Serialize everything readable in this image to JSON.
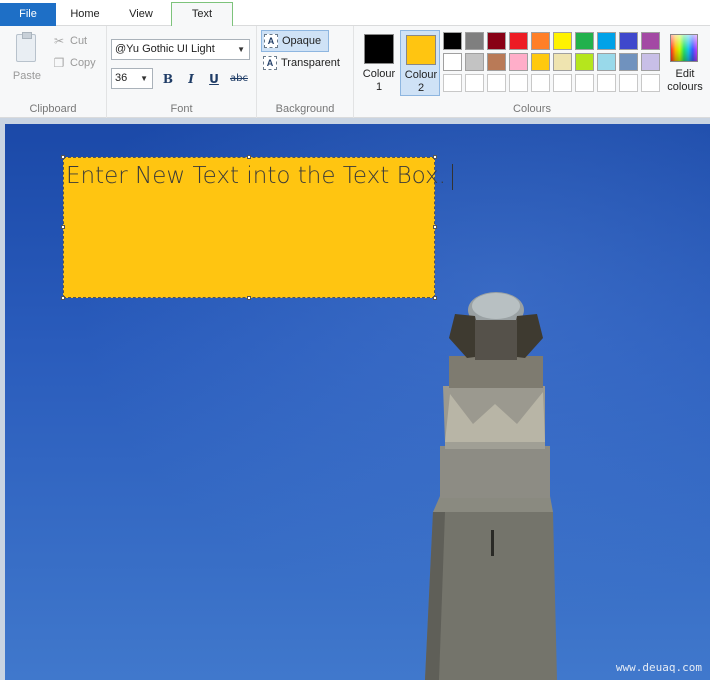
{
  "tabs": [
    {
      "label": "File"
    },
    {
      "label": "Home"
    },
    {
      "label": "View"
    },
    {
      "label": "Text"
    }
  ],
  "clipboard": {
    "paste_label": "Paste",
    "cut_label": "Cut",
    "copy_label": "Copy",
    "group_label": "Clipboard"
  },
  "font": {
    "family_value": "@Yu Gothic UI Light",
    "size_value": "36",
    "bold_label": "B",
    "italic_label": "I",
    "underline_label": "U",
    "strike_label": "abc",
    "group_label": "Font"
  },
  "background": {
    "opaque_label": "Opaque",
    "transparent_label": "Transparent",
    "group_label": "Background"
  },
  "colours": {
    "colour1_label": "Colour 1",
    "colour2_label": "Colour 2",
    "colour1_value": "#000000",
    "colour2_value": "#ffc511",
    "edit_label": "Edit colours",
    "group_label": "Colours",
    "palette_row1": [
      "#000000",
      "#7f7f7f",
      "#880015",
      "#ed1c24",
      "#ff7f27",
      "#fff200",
      "#22b14c",
      "#00a2e8",
      "#3f48cc",
      "#a349a4"
    ],
    "palette_row2": [
      "#ffffff",
      "#c3c3c3",
      "#b97a57",
      "#ffaec9",
      "#ffc90e",
      "#efe4b0",
      "#b5e61d",
      "#99d9ea",
      "#7092be",
      "#c8bfe7"
    ],
    "palette_row3": [
      "#ffffff",
      "#ffffff",
      "#ffffff",
      "#ffffff",
      "#ffffff",
      "#ffffff",
      "#ffffff",
      "#ffffff",
      "#ffffff",
      "#ffffff"
    ]
  },
  "canvas": {
    "text_box_content": "Enter New Text into the Text Box.",
    "watermark": "www.deuaq.com"
  }
}
